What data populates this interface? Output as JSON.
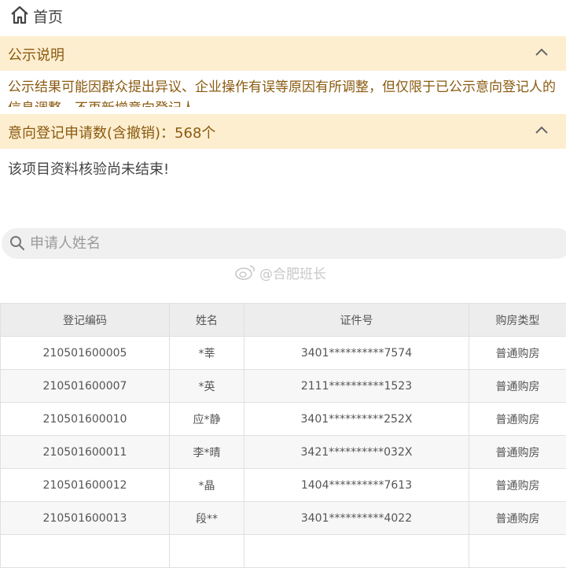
{
  "nav": {
    "home_icon": "home-icon",
    "home_label": "首页"
  },
  "notice": {
    "title": "公示说明",
    "body": "公示结果可能因群众提出异议、企业操作有误等原因有所调整，但仅限于已公示意向登记人的信息调整，不再新增意向登记人"
  },
  "applications": {
    "title": "意向登记申请数(含撤销)：568个"
  },
  "status_text": "该项目资料核验尚未结束!",
  "search": {
    "placeholder": "申请人姓名",
    "value": "",
    "icon": "search-icon"
  },
  "watermark": {
    "text": "@合肥班长",
    "icon": "weibo-icon"
  },
  "table": {
    "headers": [
      "登记编码",
      "姓名",
      "证件号",
      "购房类型"
    ],
    "rows": [
      [
        "210501600005",
        "*莘",
        "3401**********7574",
        "普通购房"
      ],
      [
        "210501600007",
        "*英",
        "2111**********1523",
        "普通购房"
      ],
      [
        "210501600010",
        "应*静",
        "3401**********252X",
        "普通购房"
      ],
      [
        "210501600011",
        "李*晴",
        "3421**********032X",
        "普通购房"
      ],
      [
        "210501600012",
        "*晶",
        "1404**********7613",
        "普通购房"
      ],
      [
        "210501600013",
        "段**",
        "3401**********4022",
        "普通购房"
      ],
      [
        "",
        "",
        "",
        ""
      ]
    ]
  },
  "colors": {
    "panel_bg": "#fdeed0",
    "panel_text": "#8a5a10",
    "header_bg": "#ededed"
  }
}
